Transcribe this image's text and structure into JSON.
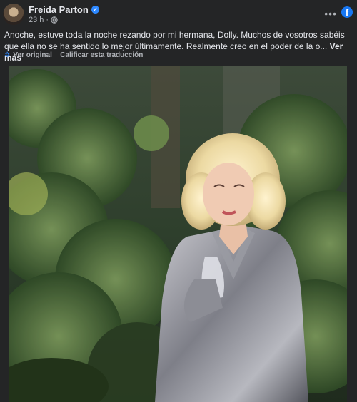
{
  "post": {
    "author_name": "Freida Parton",
    "timestamp": "23 h",
    "privacy_icon": "globe-icon",
    "more_icon": "more-options-icon",
    "brand_icon": "facebook-icon",
    "body_text": "Anoche, estuve toda la noche rezando por mi hermana, Dolly. Muchos de vosotros sabéis que ella no se ha sentido lo mejor últimamente. Realmente creo en el poder de la o...",
    "see_more_label": "Ver más",
    "translation": {
      "view_original_label": "Ver original",
      "separator": "·",
      "rate_translation_label": "Calificar esta traducción"
    }
  },
  "colors": {
    "background": "#242526",
    "text_primary": "#e4e6eb",
    "text_secondary": "#b0b3b8",
    "verified_blue": "#2d88ff",
    "facebook_blue": "#1877f2"
  }
}
